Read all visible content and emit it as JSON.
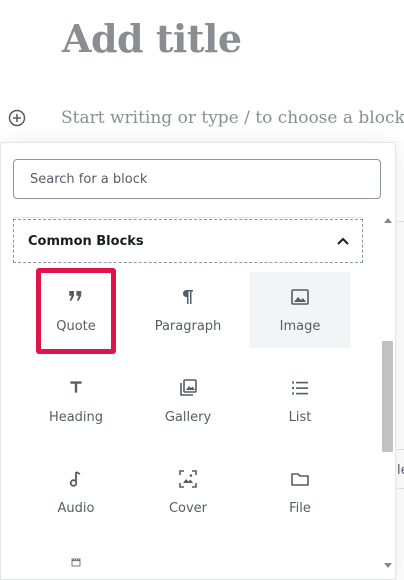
{
  "editor": {
    "title_placeholder": "Add title",
    "body_placeholder": "Start writing or type / to choose a block",
    "right_fragment_text": "le"
  },
  "inserter": {
    "search_placeholder": "Search for a block",
    "panel_title": "Common Blocks",
    "blocks": [
      {
        "label": "Quote",
        "icon": "quote-icon"
      },
      {
        "label": "Paragraph",
        "icon": "paragraph-icon"
      },
      {
        "label": "Image",
        "icon": "image-icon"
      },
      {
        "label": "Heading",
        "icon": "heading-icon"
      },
      {
        "label": "Gallery",
        "icon": "gallery-icon"
      },
      {
        "label": "List",
        "icon": "list-icon"
      },
      {
        "label": "Audio",
        "icon": "audio-icon"
      },
      {
        "label": "Cover",
        "icon": "cover-icon"
      },
      {
        "label": "File",
        "icon": "file-icon"
      },
      {
        "label": "",
        "icon": "video-icon"
      }
    ]
  },
  "colors": {
    "annotation": "#e0144b",
    "text_muted": "#555d66",
    "title": "#8a8e93"
  }
}
